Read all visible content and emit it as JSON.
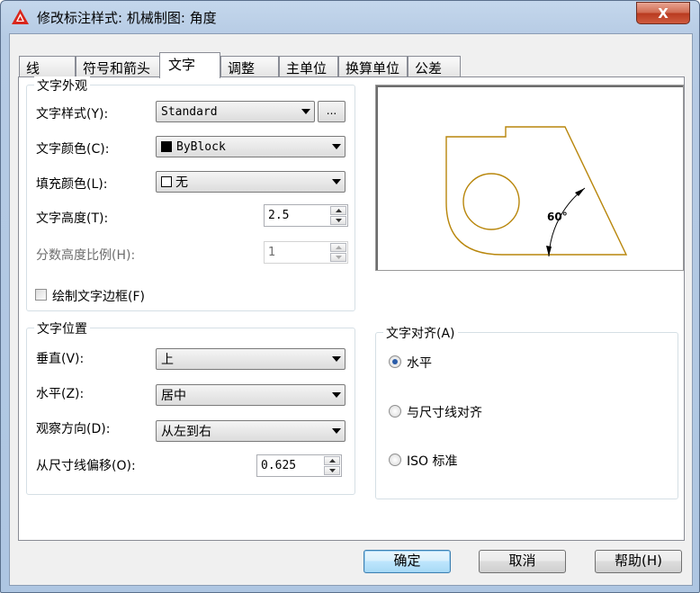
{
  "window": {
    "title": "修改标注样式: 机械制图: 角度",
    "close_label": "X"
  },
  "tabs": [
    {
      "label": "线"
    },
    {
      "label": "符号和箭头"
    },
    {
      "label": "文字"
    },
    {
      "label": "调整"
    },
    {
      "label": "主单位"
    },
    {
      "label": "换算单位"
    },
    {
      "label": "公差"
    }
  ],
  "appearance": {
    "title": "文字外观",
    "style_label": "文字样式(Y):",
    "style_value": "Standard",
    "style_button": "...",
    "color_label": "文字颜色(C):",
    "color_value": "ByBlock",
    "fill_label": "填充颜色(L):",
    "fill_value": "无",
    "height_label": "文字高度(T):",
    "height_value": "2.5",
    "fraction_label": "分数高度比例(H):",
    "fraction_value": "1",
    "frame_label": "绘制文字边框(F)",
    "frame_checked": false
  },
  "placement": {
    "title": "文字位置",
    "vertical_label": "垂直(V):",
    "vertical_value": "上",
    "horizontal_label": "水平(Z):",
    "horizontal_value": "居中",
    "view_label": "观察方向(D):",
    "view_value": "从左到右",
    "offset_label": "从尺寸线偏移(O):",
    "offset_value": "0.625"
  },
  "alignment": {
    "title": "文字对齐(A)",
    "options": [
      {
        "label": "水平",
        "selected": true
      },
      {
        "label": "与尺寸线对齐",
        "selected": false
      },
      {
        "label": "ISO 标准",
        "selected": false
      }
    ]
  },
  "preview": {
    "angle_text": "60°"
  },
  "buttons": {
    "ok": "确定",
    "cancel": "取消",
    "help": "帮助(H)"
  },
  "colors": {
    "preview_line": "#b8860b",
    "title_bar": "#b6cbe4",
    "close_button": "#c7472a"
  }
}
